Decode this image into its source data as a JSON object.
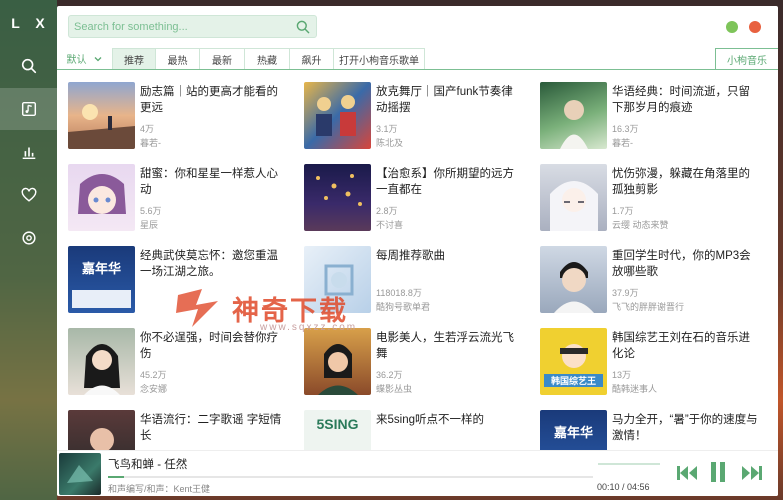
{
  "app": {
    "logo": "L X"
  },
  "sidebar": {
    "items": [
      {
        "name": "search",
        "icon": "search-icon"
      },
      {
        "name": "songlist",
        "icon": "music-list-icon",
        "active": true
      },
      {
        "name": "leaderboard",
        "icon": "bar-chart-icon"
      },
      {
        "name": "favorites",
        "icon": "heart-icon"
      },
      {
        "name": "settings",
        "icon": "gear-icon"
      }
    ]
  },
  "search": {
    "placeholder": "Search for something..."
  },
  "window_controls": {
    "minimize_color": "#7ec45a",
    "close_color": "#e8613f"
  },
  "tabs": {
    "source": "默认",
    "items": [
      "推荐",
      "最热",
      "最新",
      "热藏",
      "飙升",
      "打开小枸音乐歌单"
    ],
    "active_index": 0,
    "right": "小枸音乐"
  },
  "playlists": [
    {
      "title": "励志篇｜站的更高才能看的更远",
      "plays": "4万",
      "author": "暮若-"
    },
    {
      "title": "放克舞厅｜国产funk节奏律动摇摆",
      "plays": "3.1万",
      "author": "陈北及"
    },
    {
      "title": "华语经典：时间流逝，只留下那岁月的痕迹",
      "plays": "16.3万",
      "author": "暮若-"
    },
    {
      "title": "甜蜜：你和星星一样惹人心动",
      "plays": "5.6万",
      "author": "星辰"
    },
    {
      "title": "【治愈系】你所期望的远方一直都在",
      "plays": "2.8万",
      "author": "不讨喜"
    },
    {
      "title": "忧伤弥漫，躲藏在角落里的孤独剪影",
      "plays": "1.7万",
      "author": "云缨 动态来赞"
    },
    {
      "title": "经典武侠莫忘怀：邀您重温一场江湖之旅。",
      "plays": "",
      "author": ""
    },
    {
      "title": "每周推荐歌曲",
      "plays": "118018.8万",
      "author": "酷狗号歌单君"
    },
    {
      "title": "重回学生时代，你的MP3会放哪些歌",
      "plays": "37.9万",
      "author": "飞飞的胖胖谢晋行"
    },
    {
      "title": "你不必逞强，时间会替你疗伤",
      "plays": "45.2万",
      "author": "念安娜"
    },
    {
      "title": "电影美人，生若浮云流光飞舞",
      "plays": "36.2万",
      "author": "蝶影丛虫"
    },
    {
      "title": "韩国综艺王刘在石的音乐进化论",
      "plays": "13万",
      "author": "酷韩迷事人"
    },
    {
      "title": "华语流行：二字歌谣 字短情长",
      "plays": "",
      "author": ""
    },
    {
      "title": "来5sing听点不一样的",
      "plays": "",
      "author": ""
    },
    {
      "title": "马力全开，“暑”于你的速度与激情！",
      "plays": "",
      "author": ""
    }
  ],
  "covers": {
    "c1": "嘉年华",
    "c2": "5SING",
    "c3": "嘉年华",
    "c4": "韩国综艺王"
  },
  "player": {
    "title": "飞鸟和蝉 - 任然",
    "artist": "和声编写/和声：Kent王健",
    "time": "00:10 / 04:56",
    "progress": 0.034
  },
  "watermark": {
    "text": "神奇下载",
    "url": "www.sqxzz.com"
  },
  "colors": {
    "accent": "#5aa872",
    "accent_light": "#e4f2e8"
  }
}
